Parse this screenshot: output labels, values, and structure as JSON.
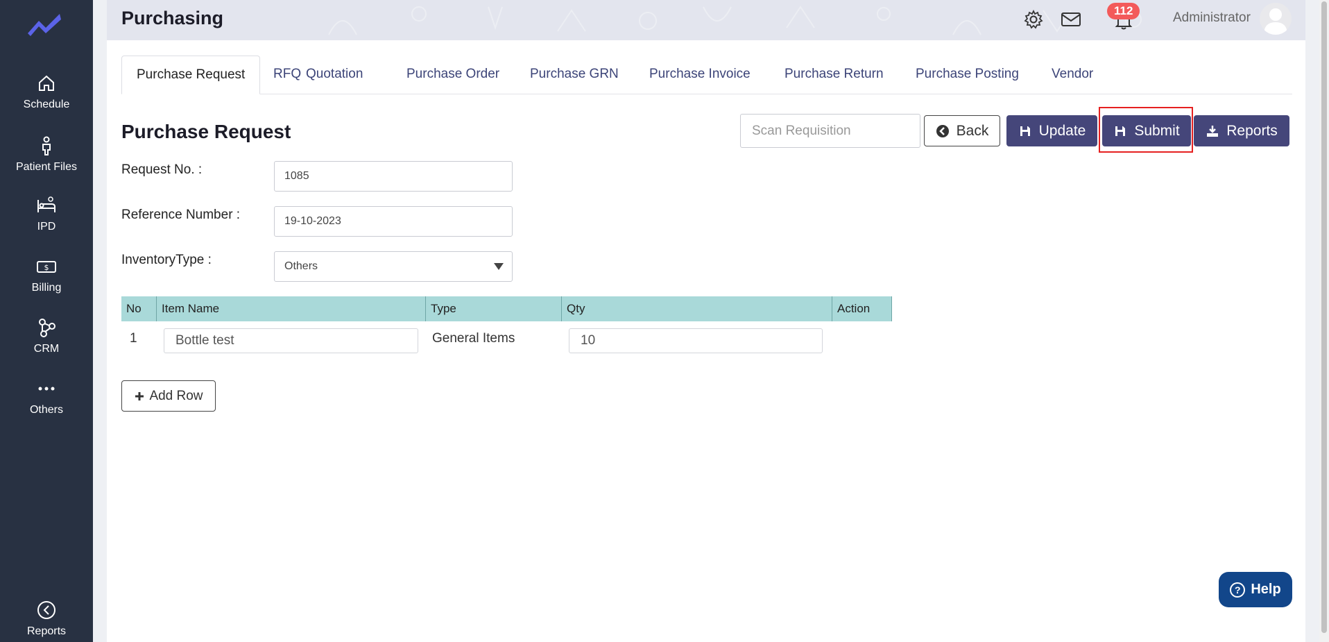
{
  "app": {
    "title": "Purchasing",
    "accent": "#45467a",
    "sidebar_bg": "#283142"
  },
  "sidebar": {
    "items": [
      {
        "label": "Schedule",
        "icon": "home-icon"
      },
      {
        "label": "Patient Files",
        "icon": "person-icon"
      },
      {
        "label": "IPD",
        "icon": "bed-icon"
      },
      {
        "label": "Billing",
        "icon": "money-icon"
      },
      {
        "label": "CRM",
        "icon": "network-icon"
      },
      {
        "label": "Others",
        "icon": "dots-icon"
      },
      {
        "label": "Reports",
        "icon": "chart-icon"
      }
    ]
  },
  "header": {
    "notification_count": "112",
    "user": "Administrator"
  },
  "tabs": [
    {
      "label": "Purchase Request",
      "active": true
    },
    {
      "label": "RFQ"
    },
    {
      "label": "Quotation"
    },
    {
      "label": "Purchase Order"
    },
    {
      "label": "Purchase GRN"
    },
    {
      "label": "Purchase Invoice"
    },
    {
      "label": "Purchase Return"
    },
    {
      "label": "Purchase Posting"
    },
    {
      "label": "Vendor"
    }
  ],
  "section": {
    "title": "Purchase Request",
    "scan_placeholder": "Scan Requisition",
    "back": "Back",
    "update": "Update",
    "submit": "Submit",
    "reports": "Reports"
  },
  "form": {
    "request_no_label": "Request No. :",
    "request_no": "1085",
    "reference_label": "Reference Number :",
    "reference": "19-10-2023",
    "inventory_label": "InventoryType :",
    "inventory": "Others"
  },
  "table": {
    "headers": [
      "No",
      "Item Name",
      "Type",
      "Qty",
      "Action"
    ],
    "rows": [
      {
        "no": "1",
        "item": "Bottle test",
        "type": "General Items",
        "qty": "10"
      }
    ]
  },
  "add_row": "Add Row",
  "help": "Help"
}
